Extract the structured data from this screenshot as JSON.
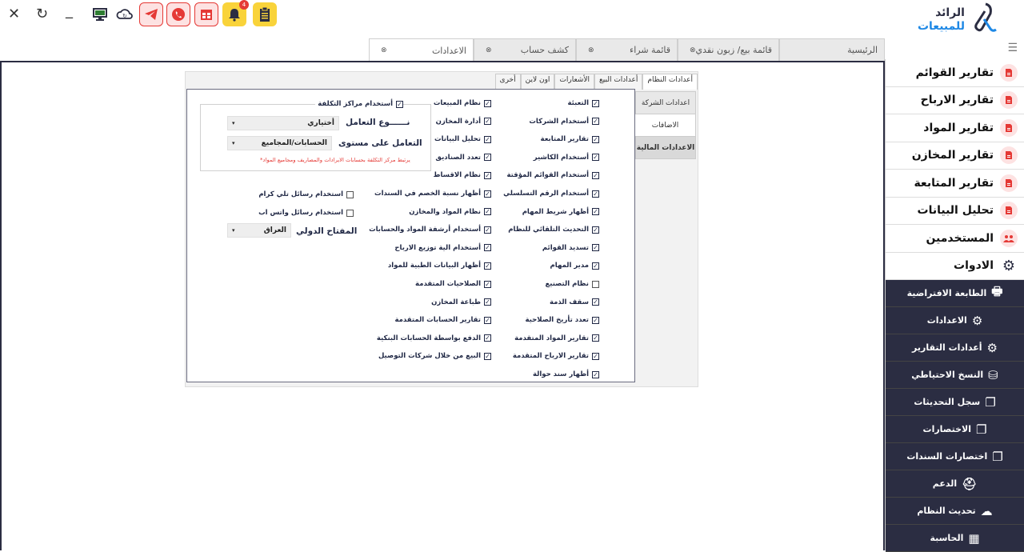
{
  "toolbar": {
    "window_controls": [
      "✕",
      "↻",
      "_"
    ],
    "notification_count": "4"
  },
  "brand": {
    "line1": "الرائد",
    "line2": "للمبيعات"
  },
  "tabs": [
    {
      "label": "الرئيسية",
      "closable": false
    },
    {
      "label": "قائمة بيع/ زبون نقدي",
      "closable": true
    },
    {
      "label": "قائمة شراء",
      "closable": true
    },
    {
      "label": "كشف حساب",
      "closable": true
    },
    {
      "label": "الاعدادات",
      "closable": true,
      "active": true
    }
  ],
  "sidebar": {
    "items": [
      {
        "label": "تقارير القوائم",
        "icon": "report-icon"
      },
      {
        "label": "تقارير الارباح",
        "icon": "report-icon"
      },
      {
        "label": "تقارير المواد",
        "icon": "report-icon"
      },
      {
        "label": "تقارير المخازن",
        "icon": "report-icon"
      },
      {
        "label": "تقارير المتابعة",
        "icon": "report-icon"
      },
      {
        "label": "تحليل البيانات",
        "icon": "report-icon"
      },
      {
        "label": "المستخدمين",
        "icon": "users-icon"
      },
      {
        "label": "الادوات",
        "icon": "gear-icon"
      }
    ],
    "subitems": [
      {
        "label": "الطابعة الافتراضية",
        "icon": "printer-icon"
      },
      {
        "label": "الاعدادات",
        "icon": "gear-icon"
      },
      {
        "label": "أعدادات التقارير",
        "icon": "gear-icon"
      },
      {
        "label": "النسخ الاحتياطي",
        "icon": "database-icon"
      },
      {
        "label": "سجل التحديثات",
        "icon": "copy-icon"
      },
      {
        "label": "الاختصارات",
        "icon": "copy-icon"
      },
      {
        "label": "اختصارات السندات",
        "icon": "copy-icon"
      },
      {
        "label": "الدعم",
        "icon": "support-icon"
      },
      {
        "label": "تحديث النظام",
        "icon": "cloud-icon"
      },
      {
        "label": "الحاسبة",
        "icon": "calculator-icon"
      }
    ]
  },
  "settings": {
    "top_tabs": [
      "أعدادات النظام",
      "أعدادات البيع",
      "الأشعارات",
      "اون لاين",
      "أخرى"
    ],
    "side_tabs": [
      "اعدادات الشركة",
      "الاضافات",
      "الاعدادات المالية"
    ],
    "col1": [
      {
        "label": "التعبئة",
        "checked": true
      },
      {
        "label": "أستخدام الشركات",
        "checked": true
      },
      {
        "label": "تقارير المتابعة",
        "checked": true
      },
      {
        "label": "أستخدام الكاشير",
        "checked": true
      },
      {
        "label": "أستخدام القوائم المؤقتة",
        "checked": true
      },
      {
        "label": "أستخدام الرقم التسلسلي",
        "checked": true
      },
      {
        "label": "أظهار شريط المهام",
        "checked": true
      },
      {
        "label": "التحديث التلقائي للنظام",
        "checked": true
      },
      {
        "label": "تسديد القوائم",
        "checked": true
      },
      {
        "label": "مدير المهام",
        "checked": true
      },
      {
        "label": "نظام التصنيع",
        "checked": false
      },
      {
        "label": "سقف الذمة",
        "checked": true
      },
      {
        "label": "تعدد تأريخ الصلاحية",
        "checked": true
      },
      {
        "label": "تقارير المواد المتقدمة",
        "checked": true
      },
      {
        "label": "تقارير الارباح المتقدمة",
        "checked": true
      },
      {
        "label": "أظهار سند حوالة",
        "checked": true
      }
    ],
    "col2": [
      {
        "label": "نظام المبيعات",
        "checked": true
      },
      {
        "label": "أدارة المخازن",
        "checked": true
      },
      {
        "label": "تحليل البيانات",
        "checked": true
      },
      {
        "label": "تعدد الصناديق",
        "checked": true
      },
      {
        "label": "نظام الاقساط",
        "checked": true
      },
      {
        "label": "أظهار نسبة الخصم في السندات",
        "checked": true
      },
      {
        "label": "نظام المواد والمخازن",
        "checked": true
      },
      {
        "label": "أستخدام أرشفة المواد والحسابات",
        "checked": true
      },
      {
        "label": "أستخدام الية توزيع الارباح",
        "checked": true
      },
      {
        "label": "أظهار البيانات الطبية للمواد",
        "checked": true
      },
      {
        "label": "الصلاحيات المتقدمة",
        "checked": true
      },
      {
        "label": "طباعة المخازن",
        "checked": true
      },
      {
        "label": "تقارير الحسابات المتقدمة",
        "checked": true
      },
      {
        "label": "الدفع بواسطة الحسابات البنكية",
        "checked": true
      },
      {
        "label": "البيع من خلال شركات التوصيل",
        "checked": true
      }
    ],
    "cost_centers": {
      "label": "أستخدام مراكز التكلفة",
      "checked": true,
      "deal_type_label": "نــــــوع التعامل",
      "deal_type_value": "أختياري",
      "level_label": "التعامل على مستوى",
      "level_value": "الحسابات/المجاميع",
      "note": "*يرتبط مركز التكلفة بحسابات الايرادات والمصاريف ومجاميع المواد"
    },
    "telegram": {
      "label": "استخدام رسائل تلي كرام",
      "checked": false
    },
    "whatsapp": {
      "label": "استخدام رسائل واتس اب",
      "checked": false
    },
    "intl_code": {
      "label": "المفتاح الدولي",
      "value": "العراق"
    }
  }
}
